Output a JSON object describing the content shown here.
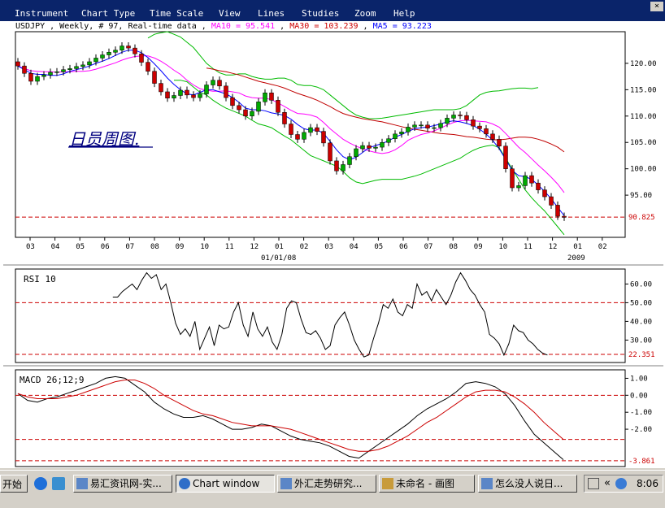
{
  "window": {
    "title": "Chart window"
  },
  "menu": [
    "Instrument",
    "Chart Type",
    "Time Scale",
    "View",
    "Lines",
    "Studies",
    "Zoom",
    "Help"
  ],
  "info": {
    "symbol": "USDJPY , Weekly, # 97, Real-time data ,",
    "ma10": "MA10 = 95.541",
    "ma30": "MA30 = 103.239",
    "ma5": "MA5 = 93.223",
    "sep1": ",",
    "sep2": ","
  },
  "colors": {
    "ma10": "#ff00ff",
    "ma30": "#c00000",
    "ma5": "#0000ff",
    "band": "#00bb00",
    "ref": "#cc0000",
    "up": "#00aa00",
    "down": "#cc0000"
  },
  "annotation": "日员周图.",
  "chart_data": [
    {
      "type": "candlestick",
      "yticks": [
        "120.00",
        "115.00",
        "110.00",
        "105.00",
        "100.00",
        "95.00"
      ],
      "ylim": [
        87,
        126
      ],
      "xticks": [
        "03",
        "04",
        "05",
        "06",
        "07",
        "08",
        "09",
        "10",
        "11",
        "12",
        "01",
        "02",
        "03",
        "04",
        "05",
        "06",
        "07",
        "08",
        "09",
        "10",
        "11",
        "12",
        "01",
        "02"
      ],
      "xdate_label": "01/01/08",
      "xyear_label": "2009",
      "reference_line": {
        "value": 90.825,
        "label": "90.825"
      },
      "close": [
        119.5,
        118.1,
        116.6,
        117.5,
        117.8,
        118.3,
        118.4,
        118.8,
        119.0,
        119.4,
        119.7,
        120.3,
        121.0,
        121.6,
        122.1,
        122.5,
        123.3,
        122.9,
        121.8,
        120.2,
        118.5,
        116.2,
        114.6,
        113.4,
        113.9,
        114.9,
        114.0,
        113.5,
        114.2,
        115.9,
        116.8,
        115.7,
        113.5,
        112.0,
        111.2,
        110.0,
        110.9,
        112.7,
        114.4,
        113.0,
        110.7,
        108.5,
        106.5,
        105.6,
        106.9,
        107.8,
        107.1,
        104.9,
        101.5,
        99.6,
        100.8,
        102.3,
        103.8,
        104.4,
        103.9,
        104.1,
        105.0,
        105.7,
        106.6,
        107.0,
        107.9,
        108.3,
        108.3,
        107.7,
        107.8,
        108.6,
        109.6,
        110.2,
        110.1,
        109.3,
        108.1,
        107.6,
        106.6,
        105.6,
        104.3,
        100.0,
        96.4,
        96.8,
        98.7,
        97.3,
        96.0,
        94.7,
        93.1,
        91.0,
        90.8
      ],
      "ma10": [
        119.5,
        119.0,
        118.6,
        118.5,
        118.4,
        118.4,
        118.3,
        118.4,
        118.4,
        118.5,
        118.5,
        118.6,
        118.9,
        119.3,
        119.7,
        120.1,
        120.6,
        121.0,
        121.3,
        121.4,
        121.4,
        121.0,
        120.4,
        119.6,
        118.7,
        117.9,
        116.8,
        115.9,
        115.2,
        114.9,
        114.7,
        114.7,
        114.8,
        114.6,
        114.4,
        113.8,
        113.5,
        113.4,
        113.4,
        113.1,
        112.5,
        111.8,
        111.1,
        110.5,
        110.4,
        110.2,
        109.8,
        108.8,
        107.6,
        106.6,
        105.6,
        104.9,
        104.3,
        103.8,
        103.4,
        103.1,
        102.9,
        103.1,
        103.6,
        104.4,
        105.4,
        106.0,
        106.5,
        106.8,
        107.2,
        107.7,
        108.3,
        108.8,
        109.1,
        109.2,
        109.1,
        109.0,
        108.9,
        108.5,
        107.9,
        106.7,
        105.4,
        104.1,
        103.1,
        101.9,
        100.7,
        99.6,
        98.4,
        97.1,
        95.5
      ],
      "ma30": [
        null,
        null,
        null,
        null,
        null,
        null,
        null,
        null,
        null,
        null,
        null,
        null,
        null,
        null,
        null,
        null,
        null,
        null,
        null,
        null,
        null,
        null,
        null,
        null,
        null,
        null,
        null,
        null,
        null,
        119.1,
        118.9,
        118.6,
        118.4,
        118.1,
        117.8,
        117.4,
        117.0,
        116.6,
        116.3,
        116.0,
        115.7,
        115.3,
        114.8,
        114.3,
        113.9,
        113.5,
        113.0,
        112.4,
        111.8,
        111.1,
        110.5,
        110.1,
        109.8,
        109.5,
        109.3,
        109.1,
        108.9,
        108.6,
        108.3,
        108.0,
        107.7,
        107.5,
        107.3,
        107.1,
        106.9,
        106.7,
        106.6,
        106.5,
        106.3,
        106.1,
        106.0,
        105.8,
        105.6,
        105.5,
        105.5,
        105.6,
        105.8,
        106.0,
        106.0,
        105.9,
        105.6,
        105.2,
        104.7,
        104.1,
        103.2
      ],
      "ma5": [
        119.5,
        118.8,
        118.1,
        117.9,
        117.9,
        117.7,
        117.7,
        118.0,
        118.5,
        118.8,
        119.1,
        119.5,
        120.0,
        120.4,
        120.9,
        121.5,
        122.1,
        122.5,
        122.5,
        122.0,
        121.1,
        119.9,
        118.6,
        117.2,
        116.0,
        115.0,
        114.2,
        114.0,
        114.5,
        115.0,
        115.0,
        114.6,
        114.2,
        113.5,
        112.6,
        111.5,
        111.2,
        111.2,
        111.0,
        110.6,
        110.4,
        110.1,
        109.4,
        108.4,
        107.6,
        107.3,
        107.4,
        106.7,
        105.2,
        103.6,
        102.3,
        101.7,
        102.2,
        103.1,
        104.0,
        104.4,
        104.8,
        105.3,
        106.0,
        106.5,
        107.1,
        107.6,
        107.8,
        107.9,
        108.2,
        108.5,
        108.9,
        109.1,
        108.9,
        108.6,
        108.2,
        107.5,
        106.6,
        105.4,
        103.8,
        101.8,
        99.7,
        98.7,
        98.5,
        98.0,
        96.9,
        95.7,
        94.3,
        92.7,
        91.1
      ],
      "bb_upper": [
        null,
        null,
        null,
        null,
        null,
        null,
        null,
        null,
        null,
        null,
        null,
        null,
        null,
        null,
        null,
        null,
        null,
        null,
        null,
        null,
        124.8,
        125.5,
        125.8,
        126.0,
        125.5,
        125.0,
        124.0,
        123.0,
        121.5,
        120.0,
        119.0,
        118.2,
        117.8,
        117.8,
        118.0,
        118.0,
        117.5,
        117.2,
        117.0,
        117.0,
        117.2,
        117.2,
        116.8,
        116.0,
        115.8,
        115.8,
        115.5,
        115.0,
        114.0,
        113.0,
        112.0,
        111.0,
        110.2,
        109.8,
        109.5,
        109.5,
        109.6,
        109.8,
        110.0,
        110.2,
        110.4,
        110.6,
        110.8,
        111.0,
        111.2,
        111.2,
        111.2,
        111.2,
        111.4,
        112.0,
        113.0,
        114.0,
        114.5,
        114.7,
        114.8,
        115.0,
        115.2,
        115.3,
        115.3,
        115.2,
        115.4
      ],
      "bb_lower": [
        null,
        null,
        null,
        null,
        null,
        null,
        null,
        null,
        null,
        null,
        null,
        null,
        null,
        null,
        null,
        null,
        null,
        null,
        null,
        null,
        null,
        null,
        null,
        null,
        116.8,
        116.8,
        116.5,
        115.5,
        114.5,
        114.0,
        113.0,
        112.2,
        111.5,
        111.0,
        110.5,
        110.0,
        109.2,
        108.5,
        108.2,
        107.8,
        107.0,
        106.2,
        105.5,
        104.5,
        103.5,
        102.5,
        102.0,
        101.5,
        101.0,
        100.5,
        99.5,
        98.3,
        97.5,
        97.2,
        97.5,
        97.8,
        98.0,
        98.0,
        98.0,
        98.0,
        98.3,
        98.6,
        99.0,
        99.5,
        100.0,
        100.5,
        101.0,
        101.5,
        102.0,
        102.8,
        103.5,
        104.0,
        104.3,
        104.5,
        104.0,
        102.0,
        100.0,
        98.0,
        96.0,
        94.5,
        93.2,
        92.0,
        90.5,
        89.0,
        87.5
      ]
    },
    {
      "type": "line",
      "label": "RSI 10",
      "yticks": [
        "60.00",
        "50.00",
        "40.00",
        "30.00"
      ],
      "ylim": [
        18,
        68
      ],
      "reference_line": {
        "value": 22.351,
        "label": "22.351"
      },
      "dashed_levels": [
        50,
        22.351
      ],
      "values": [
        null,
        null,
        null,
        null,
        null,
        null,
        null,
        null,
        null,
        null,
        null,
        null,
        null,
        null,
        null,
        null,
        null,
        null,
        null,
        null,
        53,
        53,
        56,
        58,
        60,
        57,
        62,
        66,
        63,
        65,
        57,
        60,
        50,
        39,
        33,
        36,
        32,
        40,
        25,
        31,
        37,
        27,
        38,
        36,
        37,
        45,
        50,
        38,
        32,
        45,
        36,
        32,
        37,
        29,
        25,
        33,
        47,
        51,
        50,
        41,
        34,
        33,
        35,
        31,
        25,
        27,
        38,
        42,
        45,
        38,
        30,
        25,
        21,
        22,
        31,
        39,
        49,
        47,
        52,
        45,
        43,
        49,
        47,
        60,
        54,
        56,
        51,
        57,
        53,
        49,
        54,
        61,
        66,
        62,
        57,
        54,
        49,
        45,
        33,
        31,
        28,
        22,
        28,
        38,
        35,
        34,
        30,
        28,
        25,
        23,
        22
      ],
      "x_start": 20
    },
    {
      "type": "line",
      "label": "MACD 26;12;9",
      "yticks": [
        "1.00",
        "0.00",
        "-1.00",
        "-2.00",
        "-3.861"
      ],
      "ylim": [
        -4.2,
        1.5
      ],
      "reference_line": {
        "value": -3.861,
        "label": "-3.861"
      },
      "dashed_levels": [
        0,
        -2.6
      ],
      "series": [
        {
          "color": "#000000",
          "values": [
            0.1,
            -0.3,
            -0.4,
            -0.2,
            -0.1,
            0.1,
            0.3,
            0.5,
            0.7,
            1.0,
            1.1,
            1.0,
            0.6,
            0.2,
            -0.4,
            -0.8,
            -1.1,
            -1.3,
            -1.3,
            -1.2,
            -1.4,
            -1.7,
            -2.0,
            -2.0,
            -1.9,
            -1.7,
            -1.8,
            -2.1,
            -2.4,
            -2.6,
            -2.7,
            -2.8,
            -3.0,
            -3.3,
            -3.6,
            -3.7,
            -3.3,
            -2.9,
            -2.5,
            -2.1,
            -1.7,
            -1.2,
            -0.8,
            -0.5,
            -0.2,
            0.2,
            0.7,
            0.8,
            0.7,
            0.5,
            0.1,
            -0.6,
            -1.5,
            -2.3,
            -2.8,
            -3.3,
            -3.8
          ]
        },
        {
          "color": "#cc0000",
          "values": [
            0.1,
            -0.1,
            -0.2,
            -0.2,
            -0.2,
            -0.1,
            0.0,
            0.2,
            0.4,
            0.6,
            0.8,
            0.9,
            0.9,
            0.7,
            0.4,
            0.0,
            -0.3,
            -0.6,
            -0.9,
            -1.1,
            -1.2,
            -1.4,
            -1.6,
            -1.7,
            -1.8,
            -1.8,
            -1.8,
            -1.9,
            -2.0,
            -2.2,
            -2.4,
            -2.6,
            -2.8,
            -3.0,
            -3.2,
            -3.3,
            -3.3,
            -3.2,
            -3.0,
            -2.7,
            -2.4,
            -2.0,
            -1.6,
            -1.3,
            -0.9,
            -0.5,
            -0.1,
            0.2,
            0.3,
            0.3,
            0.2,
            -0.1,
            -0.5,
            -1.0,
            -1.6,
            -2.1,
            -2.6
          ]
        }
      ]
    }
  ],
  "taskbar": {
    "start": "开始",
    "tasks": [
      "易汇资讯网-实...",
      "Chart window",
      "外汇走势研究...",
      "未命名 - 画图",
      "怎么没人说日..."
    ],
    "chevron": "«",
    "clock": "8:06"
  }
}
